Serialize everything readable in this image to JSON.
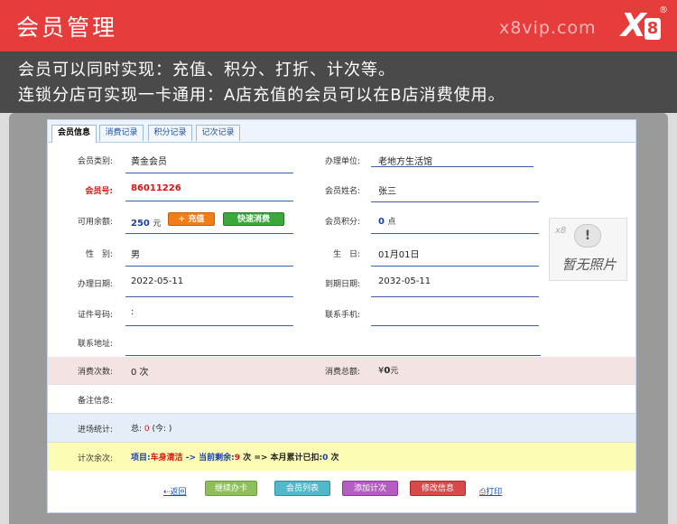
{
  "banner": {
    "title": "会员管理",
    "site": "x8vip.com",
    "logo_x": "X",
    "logo_8": "8",
    "logo_reg": "®"
  },
  "intro": {
    "line1": "会员可以同时实现：充值、积分、打折、计次等。",
    "line2": "连锁分店可实现一卡通用：A店充值的会员可以在B店消费使用。"
  },
  "tabs": [
    "会员信息",
    "消费记录",
    "积分记录",
    "记次记录"
  ],
  "form": {
    "member_type_label": "会员类别:",
    "member_type_value": "黄金会员",
    "store_label": "办理单位:",
    "store_value": "老地方生活馆",
    "card_no_label": "会员号:",
    "card_no_value": "86011226",
    "name_label": "会员姓名:",
    "name_value": "张三",
    "balance_label": "可用余额:",
    "balance_value": "250",
    "balance_unit": "元",
    "charge_btn": "+ 充值",
    "quick_btn": "快速消费",
    "points_label": "会员积分:",
    "points_value": "0",
    "points_unit": "点",
    "gender_label": "性　别:",
    "gender_value": "男",
    "birthday_label": "生　日:",
    "birthday_value": "01月01日",
    "open_date_label": "办理日期:",
    "open_date_value": "2022-05-11",
    "expire_label": "到期日期:",
    "expire_value": "2032-05-11",
    "id_label": "证件号码:",
    "id_value": ":",
    "phone_label": "联系手机:",
    "phone_value": "",
    "address_label": "联系地址:",
    "address_value": ""
  },
  "photo": {
    "text": "暂无照片",
    "bubble": "!",
    "corner": "x8"
  },
  "stats": {
    "visits_label": "消费次数:",
    "visits_value": "0 次",
    "total_label": "消费总额:",
    "total_prefix": "¥",
    "total_value": "0",
    "total_unit": "元",
    "remark_label": "备注信息:",
    "entry_label": "进场统计:",
    "entry_prefix": "总: ",
    "entry_count": "0",
    "entry_suffix": " (今: )",
    "count_label": "计次余次:",
    "count_item_prefix": "项目:",
    "count_item": "车身清洁",
    "count_arrow": " -> 当前剩余:",
    "count_remain": "9",
    "count_mid": " 次 => 本月累计已扣:",
    "count_used": "0",
    "count_end": " 次"
  },
  "footer": {
    "back": "返回",
    "continue": "继续办卡",
    "list": "会员列表",
    "add": "添加计次",
    "edit": "修改信息",
    "print": "打印"
  }
}
